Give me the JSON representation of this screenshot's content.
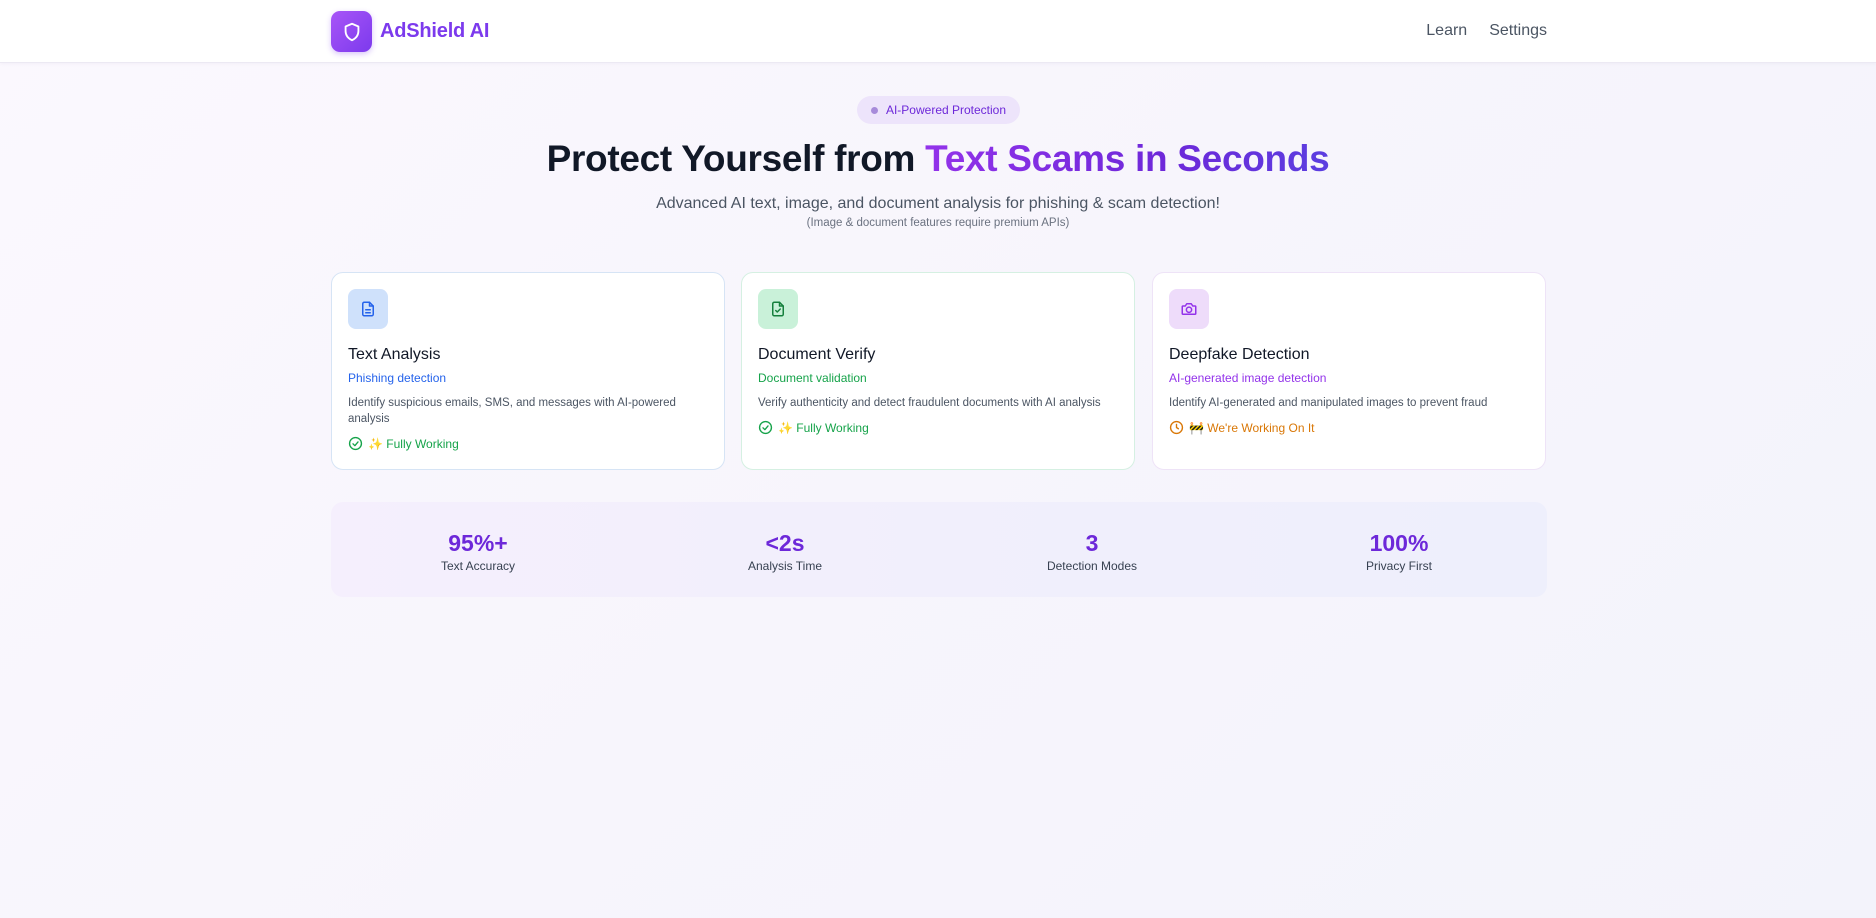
{
  "header": {
    "brand": "AdShield AI",
    "nav": [
      "Learn",
      "Settings"
    ]
  },
  "hero": {
    "badge": "AI-Powered Protection",
    "title_main": "Protect Yourself from ",
    "title_accent": "Text Scams in Seconds",
    "subtitle": "Advanced AI text, image, and document analysis for phishing & scam detection!",
    "note": "(Image & document features require premium APIs)"
  },
  "cards": [
    {
      "icon": "document-icon",
      "title": "Text Analysis",
      "subtitle": "Phishing detection",
      "description": "Identify suspicious emails, SMS, and messages with AI-powered analysis",
      "status": "✨ Fully Working"
    },
    {
      "icon": "file-check-icon",
      "title": "Document Verify",
      "subtitle": "Document validation",
      "description": "Verify authenticity and detect fraudulent documents with AI analysis",
      "status": "✨ Fully Working"
    },
    {
      "icon": "camera-icon",
      "title": "Deepfake Detection",
      "subtitle": "AI-generated image detection",
      "description": "Identify AI-generated and manipulated images to prevent fraud",
      "status": "🚧 We're Working On It"
    }
  ],
  "stats": [
    {
      "value": "95%+",
      "label": "Text Accuracy"
    },
    {
      "value": "<2s",
      "label": "Analysis Time"
    },
    {
      "value": "3",
      "label": "Detection Modes"
    },
    {
      "value": "100%",
      "label": "Privacy First"
    }
  ],
  "colors": {
    "brand": "#7c3aed",
    "accent_purple": "#9333ea",
    "blue": "#2563eb",
    "green": "#16a34a",
    "orange": "#d97706"
  }
}
